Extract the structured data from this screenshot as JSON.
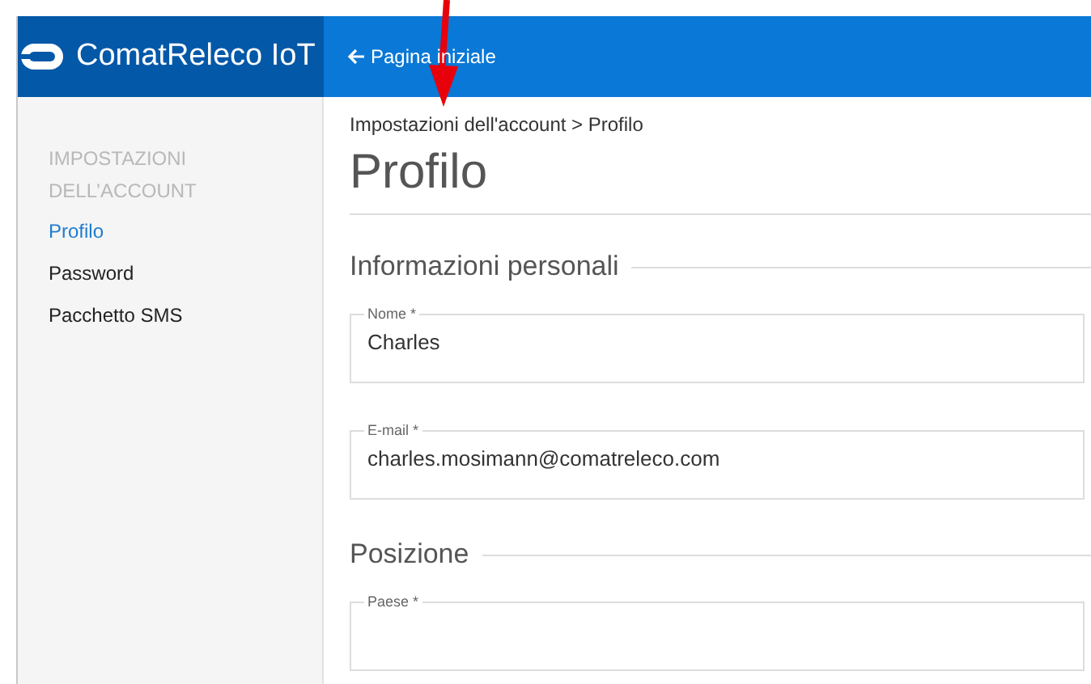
{
  "header": {
    "brand": "ComatReleco IoT",
    "back_link": "Pagina iniziale"
  },
  "sidebar": {
    "heading": "IMPOSTAZIONI DELL’ACCOUNT",
    "items": [
      {
        "label": "Profilo",
        "selected": true
      },
      {
        "label": "Password",
        "selected": false
      },
      {
        "label": "Pacchetto SMS",
        "selected": false
      }
    ]
  },
  "breadcrumb": "Impostazioni dell'account > Profilo",
  "title": "Profilo",
  "sections": [
    {
      "heading": "Informazioni personali",
      "fields": [
        {
          "label": "Nome *",
          "value": "Charles"
        },
        {
          "label": "E-mail *",
          "value": "charles.mosimann@comatreleco.com"
        }
      ]
    },
    {
      "heading": "Posizione",
      "fields": [
        {
          "label": "Paese *"
        }
      ]
    }
  ]
}
